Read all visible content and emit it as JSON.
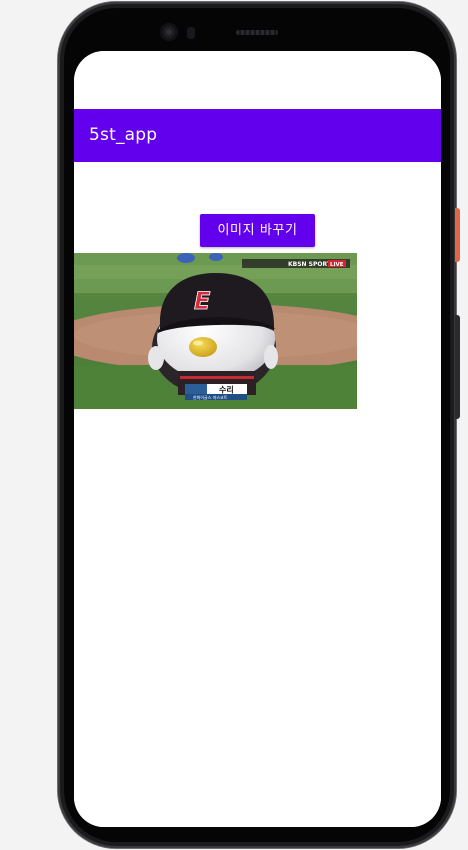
{
  "app": {
    "title": "5st_app"
  },
  "main": {
    "change_image_button": "이미지 바꾸기"
  },
  "photo": {
    "broadcast_logo": "KBSN SPORTS",
    "live_badge": "LIVE",
    "cap_logo": "E",
    "caption_name": "수리",
    "caption_sub": "한화이글스 마스코트"
  },
  "colors": {
    "primary": "#6200ee",
    "on_primary": "#ffffff",
    "screen_background": "#ffffff"
  }
}
